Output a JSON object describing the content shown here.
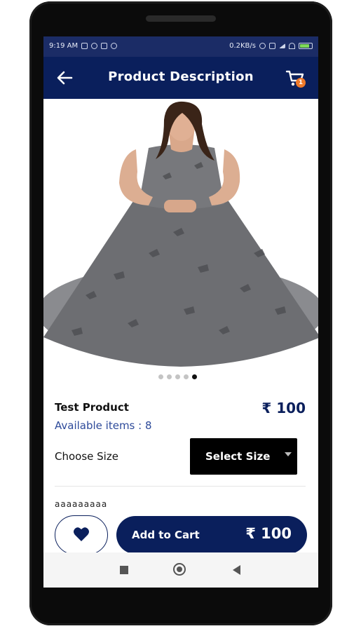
{
  "status_bar": {
    "time": "9:19 AM",
    "speed": "0.2KB/s"
  },
  "app_bar": {
    "title": "Product Description",
    "cart_count": "1"
  },
  "product": {
    "name": "Test Product",
    "price": "₹ 100",
    "availability": "Available items : 8",
    "description": "aaaaaaaaa",
    "image_pages": 5,
    "current_image_index": 5
  },
  "size": {
    "label": "Choose Size",
    "selected": "Select Size"
  },
  "actions": {
    "add_to_cart_label": "Add to Cart",
    "add_to_cart_amount": "₹ 100"
  },
  "colors": {
    "primary": "#0a1f5c",
    "badge": "#f07a2a",
    "availability_text": "#2d4a9a"
  },
  "icons": {
    "back": "arrow-left",
    "cart": "shopping-cart",
    "favorite": "heart"
  }
}
